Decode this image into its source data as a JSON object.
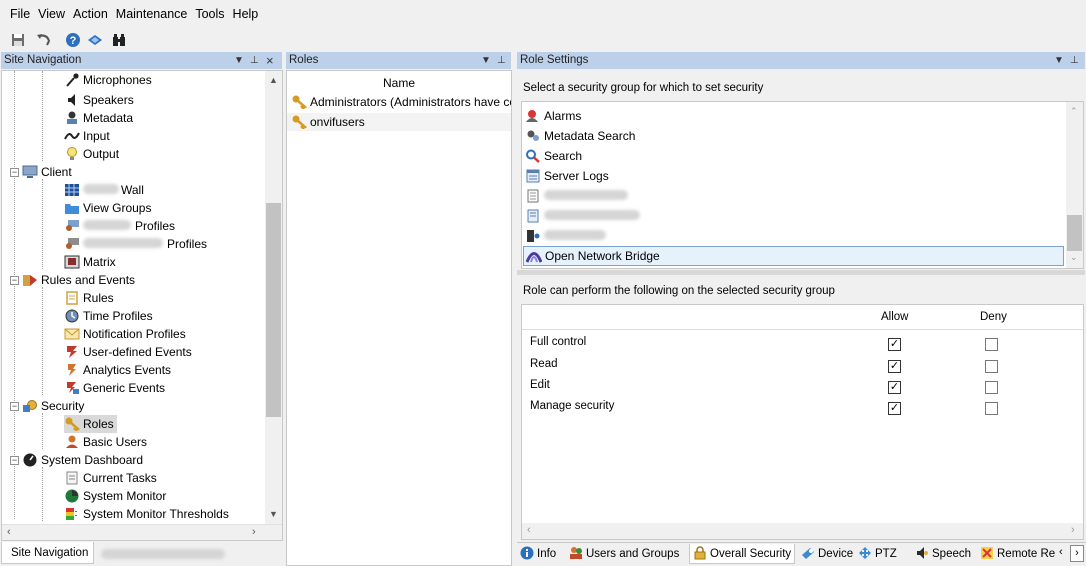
{
  "menu": [
    "File",
    "View",
    "Action",
    "Maintenance",
    "Tools",
    "Help"
  ],
  "toolbar": {
    "icons": [
      "save-icon",
      "undo-icon",
      "help-icon",
      "layers-icon",
      "binoculars-icon"
    ]
  },
  "site_navigation": {
    "title": "Site Navigation",
    "items": [
      {
        "label": "Microphones",
        "icon": "microphone-icon"
      },
      {
        "label": "Speakers",
        "icon": "speaker-icon"
      },
      {
        "label": "Metadata",
        "icon": "metadata-icon"
      },
      {
        "label": "Input",
        "icon": "input-icon"
      },
      {
        "label": "Output",
        "icon": "lightbulb-icon"
      },
      {
        "label": "Client",
        "icon": "monitor-icon"
      },
      {
        "label": "Wall",
        "icon": "wall-grid-icon"
      },
      {
        "label": "View Groups",
        "icon": "folder-icon"
      },
      {
        "label": "Profiles",
        "icon": "client-profile-icon"
      },
      {
        "label": "Profiles",
        "icon": "management-profile-icon"
      },
      {
        "label": "Matrix",
        "icon": "matrix-icon"
      },
      {
        "label": "Rules and Events",
        "icon": "rules-events-icon"
      },
      {
        "label": "Rules",
        "icon": "rules-icon"
      },
      {
        "label": "Time Profiles",
        "icon": "clock-icon"
      },
      {
        "label": "Notification Profiles",
        "icon": "envelope-icon"
      },
      {
        "label": "User-defined Events",
        "icon": "event-icon"
      },
      {
        "label": "Analytics Events",
        "icon": "analytics-event-icon"
      },
      {
        "label": "Generic Events",
        "icon": "generic-event-icon"
      },
      {
        "label": "Security",
        "icon": "security-icon"
      },
      {
        "label": "Roles",
        "icon": "roles-icon"
      },
      {
        "label": "Basic Users",
        "icon": "user-icon"
      },
      {
        "label": "System Dashboard",
        "icon": "dashboard-icon"
      },
      {
        "label": "Current Tasks",
        "icon": "tasks-icon"
      },
      {
        "label": "System Monitor",
        "icon": "monitor-circle-icon"
      },
      {
        "label": "System Monitor Thresholds",
        "icon": "thresholds-icon"
      }
    ],
    "bottom_tab": "Site Navigation"
  },
  "roles": {
    "title": "Roles",
    "column_header": "Name",
    "items": [
      "Administrators (Administrators have co",
      "onvifusers"
    ]
  },
  "role_settings": {
    "title": "Role Settings",
    "select_prompt": "Select a security group for which to set security",
    "groups": [
      {
        "label": "Alarms",
        "icon": "alarm-icon"
      },
      {
        "label": "Metadata Search",
        "icon": "metadata-search-icon"
      },
      {
        "label": "Search",
        "icon": "search-icon"
      },
      {
        "label": "Server Logs",
        "icon": "server-logs-icon"
      },
      {
        "label": "",
        "icon": "transaction-sources-icon"
      },
      {
        "label": "",
        "icon": "transaction-definitions-icon"
      },
      {
        "label": "",
        "icon": "access-control-icon"
      },
      {
        "label": "Open Network Bridge",
        "icon": "bridge-icon"
      }
    ],
    "perm_prompt": "Role can perform the following on the selected security group",
    "allow_header": "Allow",
    "deny_header": "Deny",
    "permissions": [
      {
        "label": "Full control",
        "allow": true,
        "deny": false
      },
      {
        "label": "Read",
        "allow": true,
        "deny": false
      },
      {
        "label": "Edit",
        "allow": true,
        "deny": false
      },
      {
        "label": "Manage security",
        "allow": true,
        "deny": false
      }
    ],
    "tabs": [
      "Info",
      "Users and Groups",
      "Overall Security",
      "Device",
      "PTZ",
      "Speech",
      "Remote Re"
    ]
  }
}
